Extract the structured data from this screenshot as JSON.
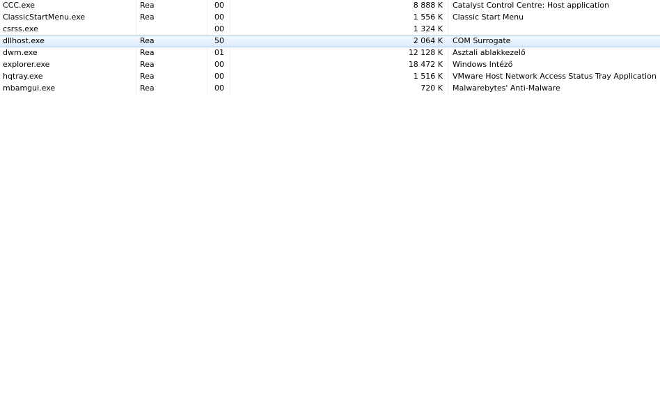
{
  "processes": [
    {
      "name": "CCC.exe",
      "user": "Rea",
      "cpu": "00",
      "memory": "8 888 K",
      "description": "Catalyst Control Centre: Host application"
    },
    {
      "name": "ClassicStartMenu.exe",
      "user": "Rea",
      "cpu": "00",
      "memory": "1 556 K",
      "description": "Classic Start Menu"
    },
    {
      "name": "csrss.exe",
      "user": "",
      "cpu": "00",
      "memory": "1 324 K",
      "description": ""
    },
    {
      "name": "dllhost.exe",
      "user": "Rea",
      "cpu": "50",
      "memory": "2 064 K",
      "description": "COM Surrogate"
    },
    {
      "name": "dwm.exe",
      "user": "Rea",
      "cpu": "01",
      "memory": "12 128 K",
      "description": "Asztali ablakkezelő"
    },
    {
      "name": "explorer.exe",
      "user": "Rea",
      "cpu": "00",
      "memory": "18 472 K",
      "description": "Windows Intéző"
    },
    {
      "name": "hqtray.exe",
      "user": "Rea",
      "cpu": "00",
      "memory": "1 516 K",
      "description": "VMware Host Network Access Status Tray Application"
    },
    {
      "name": "mbamgui.exe",
      "user": "Rea",
      "cpu": "00",
      "memory": "720 K",
      "description": "Malwarebytes' Anti-Malware"
    }
  ],
  "selected_process": "dllhost.exe"
}
